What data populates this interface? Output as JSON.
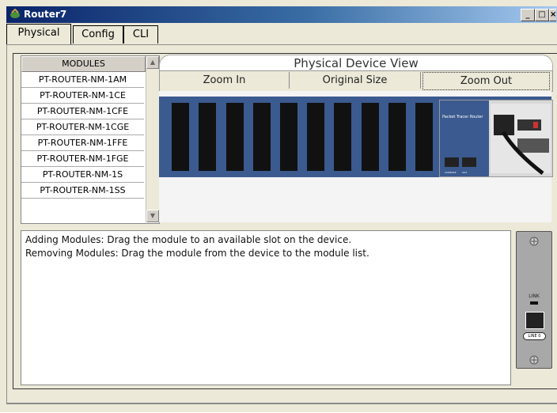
{
  "window": {
    "title": "Router7",
    "minimize_label": "_",
    "maximize_label": "□",
    "close_label": "×"
  },
  "tabs": [
    {
      "label": "Physical"
    },
    {
      "label": "Config"
    },
    {
      "label": "CLI"
    }
  ],
  "modules": {
    "header": "MODULES",
    "items": [
      "PT-ROUTER-NM-1AM",
      "PT-ROUTER-NM-1CE",
      "PT-ROUTER-NM-1CFE",
      "PT-ROUTER-NM-1CGE",
      "PT-ROUTER-NM-1FFE",
      "PT-ROUTER-NM-1FGE",
      "PT-ROUTER-NM-1S",
      "PT-ROUTER-NM-1SS"
    ]
  },
  "physical_view": {
    "title": "Physical Device View",
    "zoom_in": "Zoom In",
    "original_size": "Original Size",
    "zoom_out": "Zoom Out",
    "device_brand": "Packet Tracer Router",
    "console_label": "CONSOLE",
    "aux_label": "AUX"
  },
  "info": {
    "line1": "Adding Modules: Drag the module to an available slot on the device.",
    "line2": "Removing Modules: Drag the module from the device to the module list."
  },
  "module_preview": {
    "link_label": "LINK",
    "line_label": "LINE 0"
  },
  "colors": {
    "titlebar_start": "#0a246a",
    "device_blue": "#3b5a8f",
    "window_bg": "#ece9d8"
  }
}
